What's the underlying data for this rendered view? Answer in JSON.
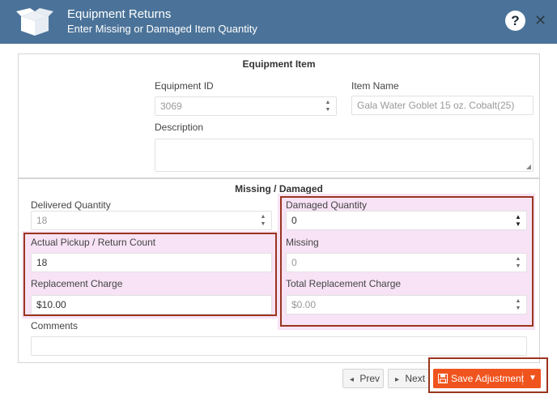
{
  "dialog": {
    "title": "Equipment Returns",
    "subtitle": "Enter Missing or Damaged Item Quantity",
    "help_glyph": "?",
    "close_glyph": "✕"
  },
  "equipment_item": {
    "section_title": "Equipment Item",
    "equipment_id_label": "Equipment ID",
    "equipment_id_value": "3069",
    "item_name_label": "Item Name",
    "item_name_value": "Gala Water Goblet 15 oz. Cobalt(25)",
    "description_label": "Description",
    "description_value": ""
  },
  "missing_damaged": {
    "section_title": "Missing / Damaged",
    "delivered_quantity_label": "Delivered Quantity",
    "delivered_quantity_value": "18",
    "actual_pickup_label": "Actual Pickup / Return Count",
    "actual_pickup_value": "18",
    "replacement_charge_label": "Replacement Charge",
    "replacement_charge_value": "$10.00",
    "damaged_quantity_label": "Damaged Quantity",
    "damaged_quantity_value": "0",
    "missing_label": "Missing",
    "missing_value": "0",
    "total_replacement_label": "Total Replacement Charge",
    "total_replacement_value": "$0.00",
    "comments_label": "Comments",
    "comments_value": ""
  },
  "footer": {
    "prev_label": "Prev",
    "prev_icon": "◂",
    "next_label": "Next",
    "next_icon": "▸",
    "save_label": "Save Adjustment",
    "save_dropdown_icon": "▼"
  },
  "colors": {
    "header_bg": "#4b7399",
    "highlight_border": "#9a3520",
    "save_button": "#f0541e"
  },
  "icons": {
    "header": "open-box-icon",
    "save": "floppy-disk-icon"
  }
}
